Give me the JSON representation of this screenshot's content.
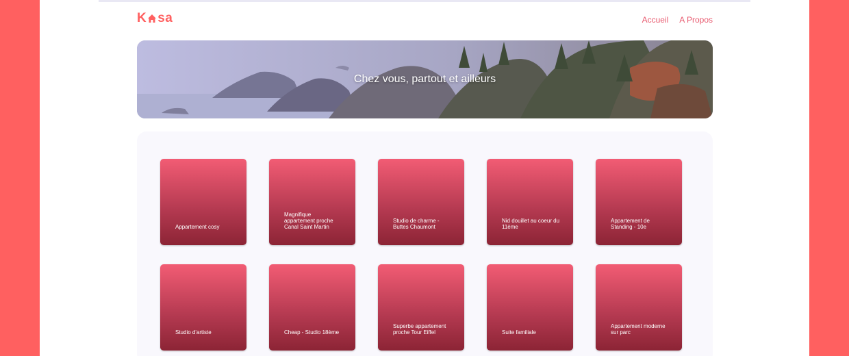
{
  "header": {
    "logo_left": "K",
    "logo_right": "sa",
    "nav": [
      {
        "label": "Accueil"
      },
      {
        "label": "A Propos"
      }
    ]
  },
  "banner": {
    "title": "Chez vous, partout et ailleurs"
  },
  "cards": [
    {
      "title": "Appartement cosy"
    },
    {
      "title": "Magnifique appartement proche Canal Saint Martin"
    },
    {
      "title": "Studio de charme - Buttes Chaumont"
    },
    {
      "title": "Nid douillet au coeur du 11ème"
    },
    {
      "title": "Appartement de Standing - 10e"
    },
    {
      "title": "Studio d'artiste"
    },
    {
      "title": "Cheap - Studio 18ème"
    },
    {
      "title": "Superbe appartement proche Tour Eiffel"
    },
    {
      "title": "Suite familiale"
    },
    {
      "title": "Appartement moderne sur parc"
    }
  ],
  "colors": {
    "brand": "#ff6060",
    "background": "#ffffff",
    "gallery": "#f9f8fd"
  },
  "icons": {
    "logo_house": "house-icon"
  }
}
